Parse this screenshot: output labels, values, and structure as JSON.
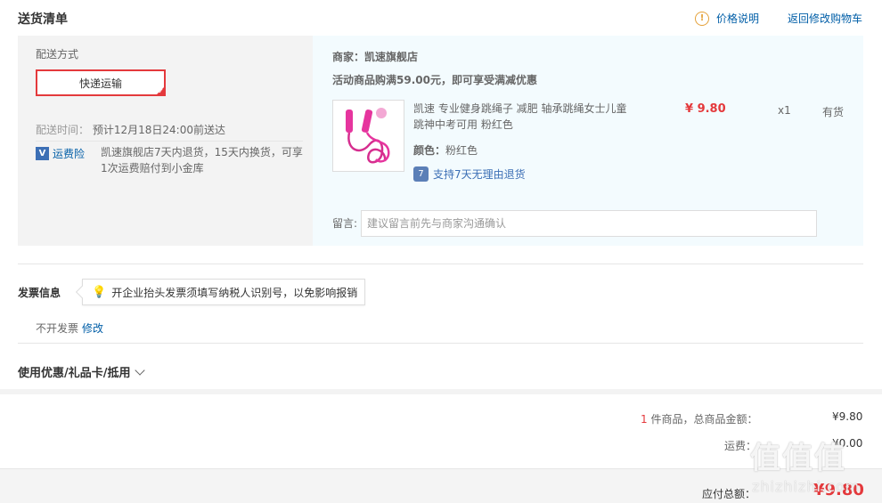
{
  "header": {
    "title": "送货清单",
    "price_note": "价格说明",
    "return_cart": "返回修改购物车"
  },
  "delivery": {
    "label": "配送方式",
    "method": "快递运输",
    "time_label": "配送时间：",
    "time_value": "预计12月18日24:00前送达",
    "insurance_link": "运费险",
    "insurance_text": "凯速旗舰店7天内退货，15天内换货，可享1次运费赔付到小金库"
  },
  "shop": {
    "name": "商家：凯速旗舰店",
    "promo": "活动商品购满59.00元，即可享受满减优惠"
  },
  "product": {
    "name": "凯速 专业健身跳绳子 减肥 轴承跳绳女士儿童跳神中考可用 粉红色",
    "price": "¥ 9.80",
    "qty": "x1",
    "stock": "有货",
    "color_label": "颜色：",
    "color_value": "粉红色",
    "return_policy": "支持7天无理由退货",
    "image_color": "#e6359e"
  },
  "message": {
    "label": "留言:",
    "placeholder": "建议留言前先与商家沟通确认"
  },
  "invoice": {
    "title": "发票信息",
    "tip": "开企业抬头发票须填写纳税人识别号，以免影响报销",
    "status": "不开发票",
    "edit": "修改"
  },
  "coupon": {
    "title": "使用优惠/礼品卡/抵用"
  },
  "summary": {
    "count": "1",
    "count_suffix": " 件商品，总商品金额：",
    "goods_total": "¥9.80",
    "shipping_label": "运费：",
    "shipping_value": "¥0.00",
    "payable_label": "应付总额：",
    "payable_value": "¥9.80"
  },
  "watermark": {
    "text": "值值值",
    "site": "zhizhizhi.com"
  },
  "colors": {
    "accent": "#e4393c",
    "link": "#005ea7"
  }
}
